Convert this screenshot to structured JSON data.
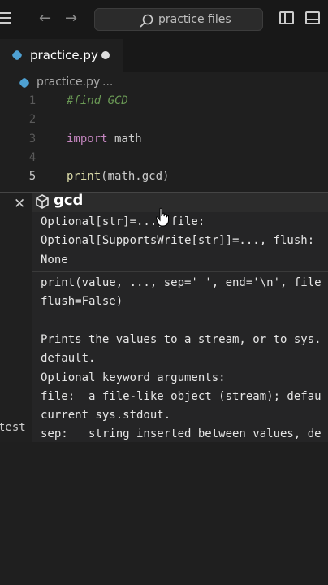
{
  "titlebar": {
    "search_placeholder": "practice files"
  },
  "tab": {
    "filename": "practice.py",
    "unsaved": true
  },
  "breadcrumb": {
    "file": "practice.py",
    "sep": "..."
  },
  "editor": {
    "lines": [
      {
        "num": "1",
        "text": "#find GCD"
      },
      {
        "num": "2",
        "text": ""
      },
      {
        "num": "3",
        "kw": "import",
        "rest": " math"
      },
      {
        "num": "4",
        "text": ""
      },
      {
        "num": "5",
        "fn": "print",
        "arg": "(math.gcd)"
      }
    ],
    "active_line": "5"
  },
  "suggest": {
    "item": "gcd",
    "doc_lines": [
      "Optional[str]=..., file:",
      "Optional[SupportsWrite[str]]=..., flush:",
      "None",
      "print(value, ..., sep=' ', end='\\n', file",
      "flush=False)",
      "",
      "Prints the values to a stream, or to sys.",
      "default.",
      "Optional keyword arguments:",
      "file:  a file-like object (stream); defau",
      "current sys.stdout.",
      "sep:   string inserted between values, de"
    ]
  },
  "side_text": "test",
  "colors": {
    "background": "#1f1f1f",
    "titlebar": "#181818",
    "comment": "#6a9955",
    "keyword": "#c586c0",
    "function": "#dcdcaa",
    "python_icon": "#4ea1d3"
  }
}
